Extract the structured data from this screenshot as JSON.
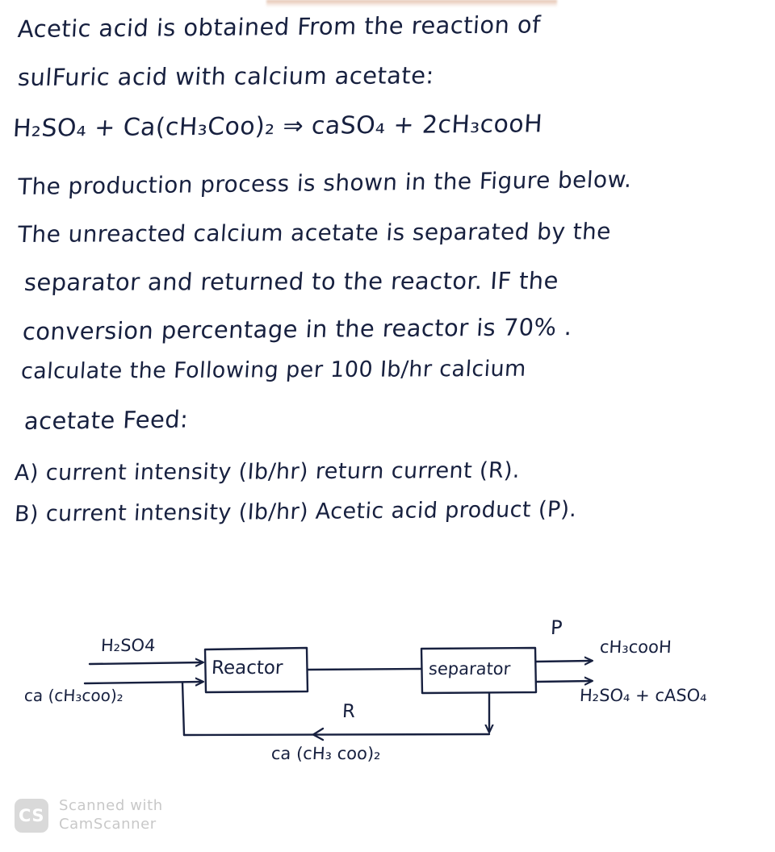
{
  "document": {
    "type": "handwritten-problem-statement",
    "ink_color": "#17203f",
    "paper_color": "#ffffff",
    "body_lines": [
      "Acetic acid is obtained From the reaction of",
      "sulFuric acid with calcium acetate:",
      "The production process is shown in the Figure below.",
      "The unreacted calcium acetate is separated by the",
      "separator and returned to the reactor. IF the",
      "conversion percentage in the reactor is 70% .",
      "calculate the Following per 100 Ib/hr calcium",
      "acetate Feed:"
    ],
    "equation": {
      "reactant_1": "H₂SO₄",
      "plus": "+",
      "reactant_2": "Ca(cH₃Coo)₂",
      "arrow": "⇒",
      "product_1": "caSO₄",
      "plus_2": "+",
      "product_2": "2cH₃cooH",
      "full": "H₂SO₄ + Ca(cH₃Coo)₂ ⇒ caSO₄ + 2cH₃cooH"
    },
    "questions": [
      "A) current intensity (Ib/hr) return current (R).",
      "B) current intensity (Ib/hr) Acetic acid product (P)."
    ],
    "given": {
      "conversion_percent": "70%",
      "basis_feed": "100 Ib/hr calcium acetate"
    }
  },
  "diagram": {
    "title": "process flow diagram",
    "units": [
      {
        "id": "reactor",
        "label": "Reactor"
      },
      {
        "id": "separator",
        "label": "separator"
      }
    ],
    "feeds": [
      {
        "id": "feed-sulfuric",
        "label": "H₂SO4"
      },
      {
        "id": "feed-calcium-acetate",
        "label": "ca (cH₃coo)₂"
      }
    ],
    "streams": [
      {
        "id": "recycle",
        "label": "R",
        "composition": "ca (cH₃ coo)₂"
      },
      {
        "id": "product",
        "label": "P",
        "composition": "cH₃cooH"
      },
      {
        "id": "bottoms",
        "label": "",
        "composition": "H₂SO₄ + cASO₄"
      }
    ]
  },
  "watermark": {
    "badge": "CS",
    "line1": "Scanned with",
    "line2": "CamScanner"
  }
}
